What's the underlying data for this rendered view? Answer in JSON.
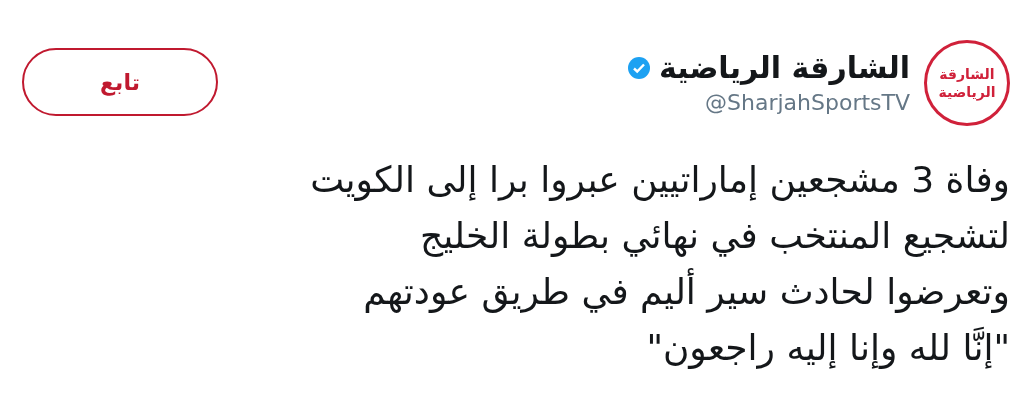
{
  "account": {
    "avatar_text": "الشارقة الرياضية",
    "name": "الشارقة الرياضية",
    "verified": true,
    "handle": "@SharjahSportsTV"
  },
  "follow_button": {
    "label": "تابع"
  },
  "tweet_lines": [
    "وفاة 3 مشجعين إماراتيين عبروا برا إلى الكويت",
    "لتشجيع المنتخب في نهائي بطولة الخليج",
    "وتعرضوا لحادث سير أليم في طريق عودتهم",
    "\"إنَّا لله وإنا إليه راجعون\""
  ]
}
